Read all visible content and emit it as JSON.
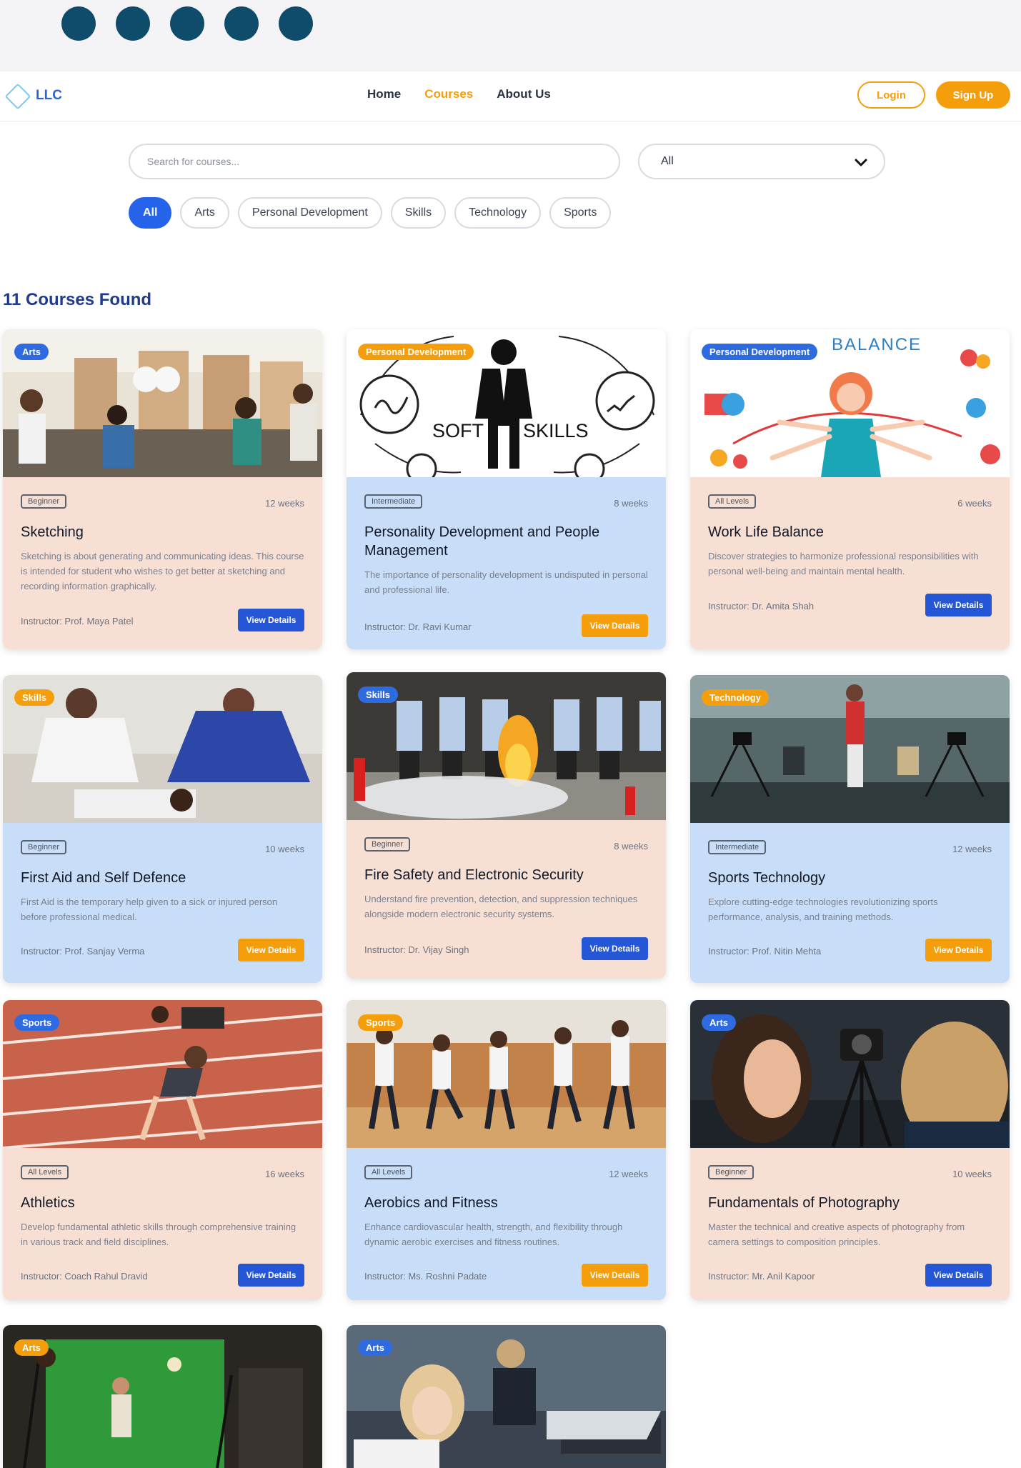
{
  "brand": {
    "name": "LLC"
  },
  "nav": {
    "links": [
      "Home",
      "Courses",
      "About Us"
    ],
    "active": "Courses",
    "login": "Login",
    "signup": "Sign Up"
  },
  "search": {
    "placeholder": "Search for courses...",
    "select_value": "All"
  },
  "filters": [
    "All",
    "Arts",
    "Personal Development",
    "Skills",
    "Technology",
    "Sports"
  ],
  "results": {
    "label": "11 Courses Found"
  },
  "colors": {
    "accent_orange": "#f59e0b",
    "accent_blue": "#2563eb",
    "card_peach": "#f7dfd3",
    "card_blue": "#c8ddf8",
    "heading": "#1e3a8a"
  },
  "courses": [
    {
      "category": "Arts",
      "level": "Beginner",
      "duration": "12 weeks",
      "title": "Sketching",
      "description": "Sketching is about generating and communicating ideas. This course is intended for student who wishes to get better at sketching and recording information graphically.",
      "instructor": "Instructor: Prof. Maya Patel",
      "button": "View Details"
    },
    {
      "category": "Personal Development",
      "level": "Intermediate",
      "duration": "8 weeks",
      "title": "Personality Development and People Management",
      "description": "The importance of personality development is undisputed in personal and professional life.",
      "instructor": "Instructor: Dr. Ravi Kumar",
      "button": "View Details",
      "image_text": [
        "SOFT",
        "SKILLS"
      ]
    },
    {
      "category": "Personal Development",
      "level": "All Levels",
      "duration": "6 weeks",
      "title": "Work Life Balance",
      "description": "Discover strategies to harmonize professional responsibilities with personal well-being and maintain mental health.",
      "instructor": "Instructor: Dr. Amita Shah",
      "button": "View Details",
      "image_text": [
        "BALANCE"
      ]
    },
    {
      "category": "Skills",
      "level": "Beginner",
      "duration": "10 weeks",
      "title": "First Aid and Self Defence",
      "description": "First Aid is the temporary help given to a sick or injured person before professional medical.",
      "instructor": "Instructor: Prof. Sanjay Verma",
      "button": "View Details"
    },
    {
      "category": "Skills",
      "level": "Beginner",
      "duration": "8 weeks",
      "title": "Fire Safety and Electronic Security",
      "description": "Understand fire prevention, detection, and suppression techniques alongside modern electronic security systems.",
      "instructor": "Instructor: Dr. Vijay Singh",
      "button": "View Details"
    },
    {
      "category": "Technology",
      "level": "Intermediate",
      "duration": "12 weeks",
      "title": "Sports Technology",
      "description": "Explore cutting-edge technologies revolutionizing sports performance, analysis, and training methods.",
      "instructor": "Instructor: Prof. Nitin Mehta",
      "button": "View Details"
    },
    {
      "category": "Sports",
      "level": "All Levels",
      "duration": "16 weeks",
      "title": "Athletics",
      "description": "Develop fundamental athletic skills through comprehensive training in various track and field disciplines.",
      "instructor": "Instructor: Coach Rahul Dravid",
      "button": "View Details"
    },
    {
      "category": "Sports",
      "level": "All Levels",
      "duration": "12 weeks",
      "title": "Aerobics and Fitness",
      "description": "Enhance cardiovascular health, strength, and flexibility through dynamic aerobic exercises and fitness routines.",
      "instructor": "Instructor: Ms. Roshni Padate",
      "button": "View Details"
    },
    {
      "category": "Arts",
      "level": "Beginner",
      "duration": "10 weeks",
      "title": "Fundamentals of Photography",
      "description": "Master the technical and creative aspects of photography from camera settings to composition principles.",
      "instructor": "Instructor: Mr. Anil Kapoor",
      "button": "View Details"
    },
    {
      "category": "Arts"
    },
    {
      "category": "Arts"
    }
  ]
}
